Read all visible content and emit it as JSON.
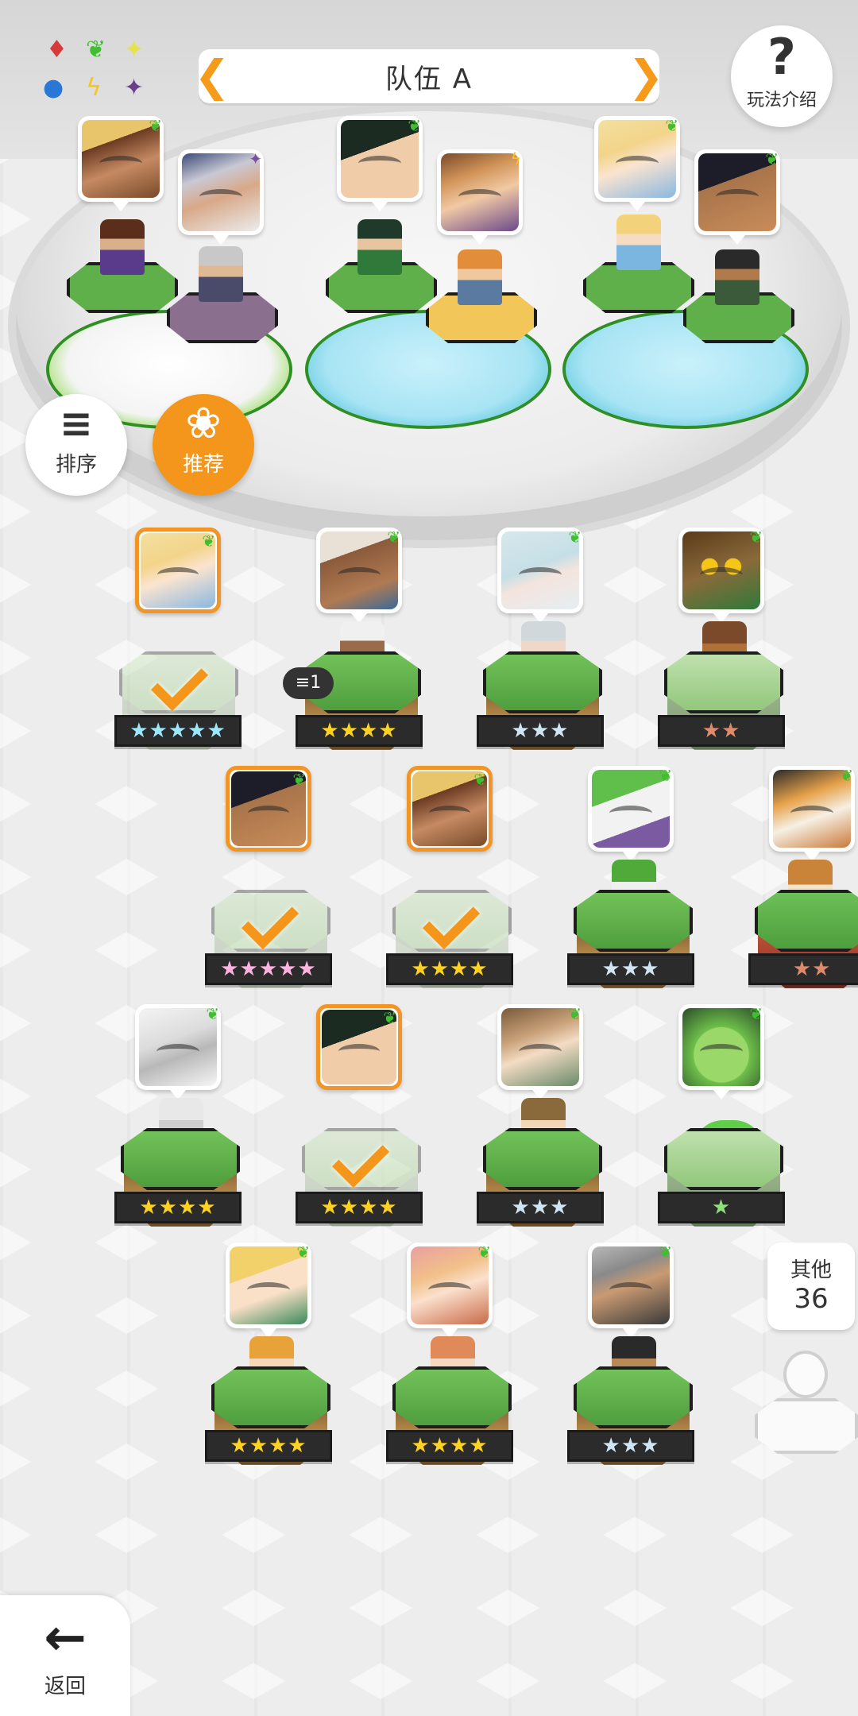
{
  "header": {
    "team_title": "队伍 A",
    "prev_arrow": "❮",
    "next_arrow": "❯",
    "help_icon": "?",
    "help_label": "玩法介绍"
  },
  "element_legend": [
    {
      "icon": "diamond-icon",
      "color": "#d83a3a"
    },
    {
      "icon": "leaf-icon",
      "color": "#3fbf2f"
    },
    {
      "icon": "sparkle-icon",
      "color": "#e6e24a"
    },
    {
      "icon": "circle-icon",
      "color": "#2a78d6"
    },
    {
      "icon": "lightning-icon",
      "color": "#f5c518"
    },
    {
      "icon": "dark-star-icon",
      "color": "#6b3f8c"
    }
  ],
  "controls": {
    "sort_label": "排序",
    "recommend_label": "推荐",
    "back_label": "返回",
    "other_label": "其他",
    "other_count": "36",
    "dupe_badge": "1"
  },
  "team_slots": [
    {
      "element": "nature"
    },
    {
      "element": "dark"
    },
    {
      "element": "nature"
    },
    {
      "element": "light"
    },
    {
      "element": "nature"
    },
    {
      "element": "nature"
    }
  ],
  "roster": [
    {
      "stars": "★★★★★",
      "rarity": "rainbow",
      "selected": true
    },
    {
      "stars": "★★★★",
      "rarity": "gold",
      "selected": false
    },
    {
      "stars": "★★★",
      "rarity": "silver",
      "selected": false
    },
    {
      "stars": "★★",
      "rarity": "bronze",
      "selected": false
    },
    {
      "stars": "★★★★★",
      "rarity": "rainbow",
      "selected": true
    },
    {
      "stars": "★★★★",
      "rarity": "gold",
      "selected": true
    },
    {
      "stars": "★★★",
      "rarity": "silver",
      "selected": false
    },
    {
      "stars": "★★",
      "rarity": "bronze",
      "selected": false
    },
    {
      "stars": "★★★★",
      "rarity": "gold",
      "selected": false
    },
    {
      "stars": "★★★★",
      "rarity": "gold",
      "selected": true
    },
    {
      "stars": "★★★",
      "rarity": "silver",
      "selected": false
    },
    {
      "stars": "★",
      "rarity": "silver",
      "selected": false
    },
    {
      "stars": "★★★★",
      "rarity": "gold",
      "selected": false
    },
    {
      "stars": "★★★★",
      "rarity": "gold",
      "selected": false
    },
    {
      "stars": "★★★",
      "rarity": "silver",
      "selected": false
    }
  ]
}
